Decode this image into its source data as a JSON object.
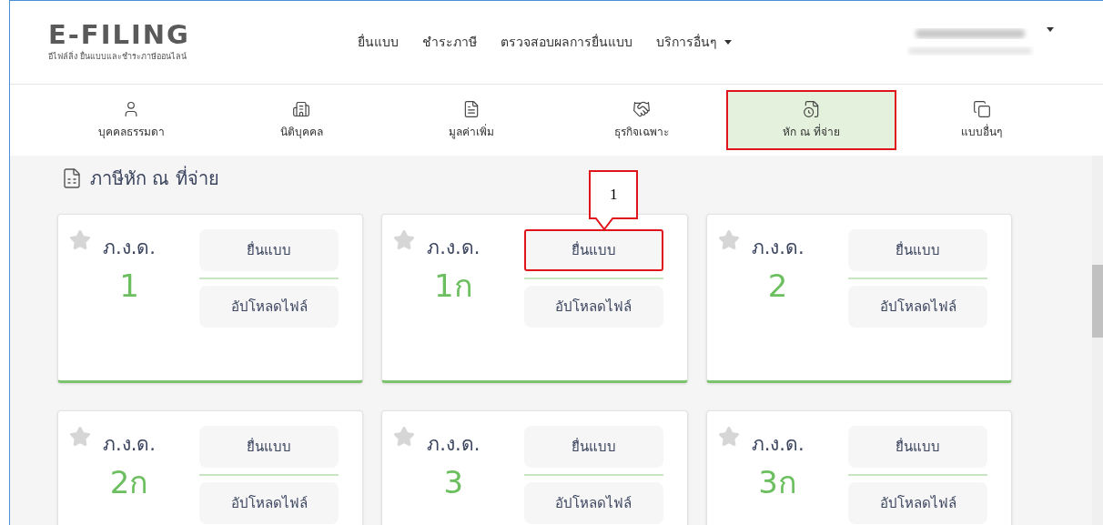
{
  "header": {
    "logo": {
      "title": "E-FILING",
      "subtitle": "อีไฟล์ลิ่ง ยื่นแบบและชำระภาษีออนไลน์"
    },
    "menu": [
      {
        "label": "ยื่นแบบ",
        "dropdown": false
      },
      {
        "label": "ชำระภาษี",
        "dropdown": false
      },
      {
        "label": "ตรวจสอบผลการยื่นแบบ",
        "dropdown": false
      },
      {
        "label": "บริการอื่นๆ",
        "dropdown": true
      }
    ],
    "user_menu": {
      "dropdown": true
    }
  },
  "tabs": [
    {
      "label": "บุคคลธรรมดา",
      "selected": false,
      "annotated": false
    },
    {
      "label": "นิติบุคคล",
      "selected": false,
      "annotated": false
    },
    {
      "label": "มูลค่าเพิ่ม",
      "selected": false,
      "annotated": false
    },
    {
      "label": "ธุรกิจเฉพาะ",
      "selected": false,
      "annotated": false
    },
    {
      "label": "หัก ณ ที่จ่าย",
      "selected": true,
      "annotated": true
    },
    {
      "label": "แบบอื่นๆ",
      "selected": false,
      "annotated": false
    }
  ],
  "section": {
    "title": "ภาษีหัก ณ ที่จ่าย"
  },
  "cards": [
    {
      "form": "ภ.ง.ด.",
      "number": "1",
      "starred": false,
      "actions": [
        {
          "label": "ยื่นแบบ",
          "annotated": false
        },
        {
          "label": "อัปโหลดไฟล์",
          "annotated": false
        }
      ]
    },
    {
      "form": "ภ.ง.ด.",
      "number": "1ก",
      "starred": false,
      "callout": "1",
      "actions": [
        {
          "label": "ยื่นแบบ",
          "annotated": true
        },
        {
          "label": "อัปโหลดไฟล์",
          "annotated": false
        }
      ]
    },
    {
      "form": "ภ.ง.ด.",
      "number": "2",
      "starred": false,
      "actions": [
        {
          "label": "ยื่นแบบ",
          "annotated": false
        },
        {
          "label": "อัปโหลดไฟล์",
          "annotated": false
        }
      ]
    },
    {
      "form": "ภ.ง.ด.",
      "number": "2ก",
      "starred": false,
      "actions": [
        {
          "label": "ยื่นแบบ",
          "annotated": false
        },
        {
          "label": "อัปโหลดไฟล์",
          "annotated": false
        }
      ]
    },
    {
      "form": "ภ.ง.ด.",
      "number": "3",
      "starred": false,
      "actions": [
        {
          "label": "ยื่นแบบ",
          "annotated": false
        },
        {
          "label": "อัปโหลดไฟล์",
          "annotated": false
        }
      ]
    },
    {
      "form": "ภ.ง.ด.",
      "number": "3ก",
      "starred": false,
      "actions": [
        {
          "label": "ยื่นแบบ",
          "annotated": false
        },
        {
          "label": "อัปโหลดไฟล์",
          "annotated": false
        }
      ]
    }
  ]
}
